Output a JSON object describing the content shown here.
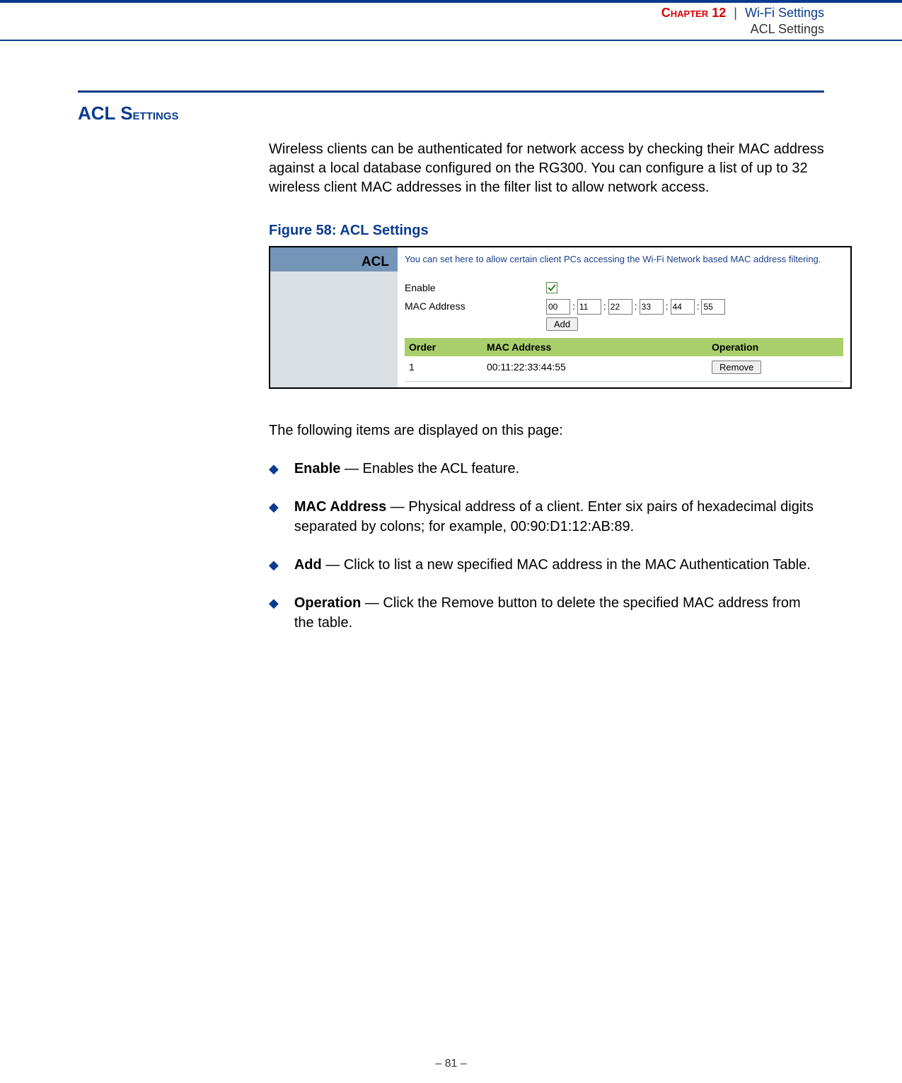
{
  "header": {
    "chapter_label": "Chapter",
    "chapter_num": "12",
    "separator": "|",
    "breadcrumb1": "Wi-Fi Settings",
    "breadcrumb2": "ACL Settings"
  },
  "section": {
    "title_prefix": "ACL S",
    "title_rest": "ettings",
    "intro": "Wireless clients can be authenticated for network access by checking their MAC address against a local database configured on the RG300. You can configure a list of up to 32 wireless client MAC addresses in the filter list to allow network access."
  },
  "figure": {
    "caption": "Figure 58:  ACL Settings",
    "panel": {
      "side_label": "ACL",
      "hint": "You can set here to allow certain client PCs accessing the Wi-Fi Network based MAC address filtering.",
      "enable_label": "Enable",
      "enable_checked": true,
      "mac_label": "MAC Address",
      "mac_fields": [
        "00",
        "11",
        "22",
        "33",
        "44",
        "55"
      ],
      "add_button": "Add",
      "table": {
        "head_order": "Order",
        "head_mac": "MAC Address",
        "head_op": "Operation",
        "rows": [
          {
            "order": "1",
            "mac": "00:11:22:33:44:55",
            "op_button": "Remove"
          }
        ]
      }
    }
  },
  "followup": "The following items are displayed on this page:",
  "bullets": [
    {
      "term": "Enable",
      "rest": " — Enables the ACL feature."
    },
    {
      "term": "MAC Address",
      "rest": " — Physical address of a client. Enter six pairs of hexadecimal digits separated by colons; for example, 00:90:D1:12:AB:89."
    },
    {
      "term": "Add",
      "rest": " — Click to list a new specified MAC address in the MAC Authentication Table."
    },
    {
      "term": "Operation",
      "rest": " — Click the Remove button to delete the specified MAC address from the table."
    }
  ],
  "page_number": "–  81  –"
}
